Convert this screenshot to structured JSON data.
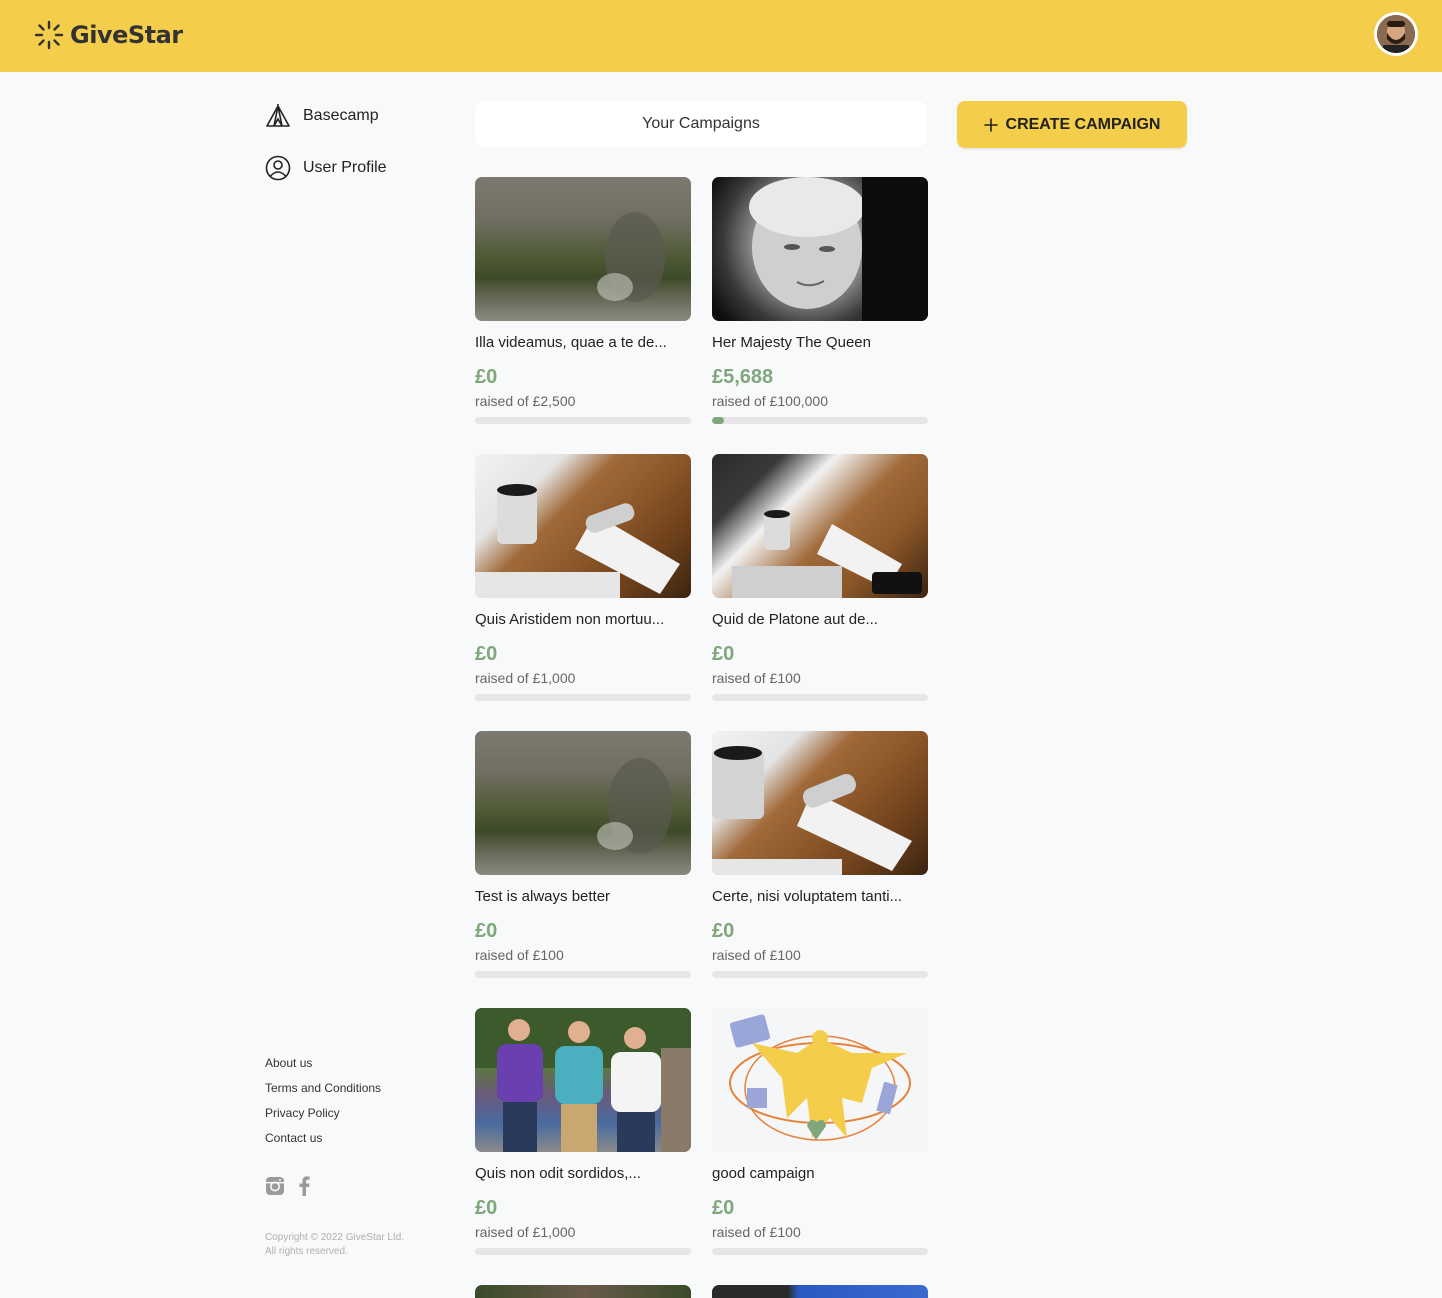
{
  "brand": {
    "name": "GiveStar",
    "color": "#f4ce4a"
  },
  "user": {
    "avatar_icon": "user-avatar"
  },
  "sidebar": {
    "items": [
      {
        "label": "Basecamp",
        "icon": "tent-icon"
      },
      {
        "label": "User Profile",
        "icon": "user-circle-icon"
      }
    ]
  },
  "main": {
    "tab_label": "Your Campaigns",
    "create_label": "CREATE CAMPAIGN"
  },
  "campaigns": [
    {
      "title": "Illa videamus, quae a te de...",
      "raised": "£0",
      "goal": "raised of £2,500",
      "progress": 0
    },
    {
      "title": "Her Majesty The Queen",
      "raised": "£5,688",
      "goal": "raised of £100,000",
      "progress": 0.057
    },
    {
      "title": "Quis Aristidem non mortuu...",
      "raised": "£0",
      "goal": "raised of £1,000",
      "progress": 0
    },
    {
      "title": "Quid de Platone aut de...",
      "raised": "£0",
      "goal": "raised of £100",
      "progress": 0
    },
    {
      "title": "Test is always better",
      "raised": "£0",
      "goal": "raised of £100",
      "progress": 0
    },
    {
      "title": "Certe, nisi voluptatem tanti...",
      "raised": "£0",
      "goal": "raised of £100",
      "progress": 0
    },
    {
      "title": "Quis non odit sordidos,...",
      "raised": "£0",
      "goal": "raised of £1,000",
      "progress": 0
    },
    {
      "title": "good campaign",
      "raised": "£0",
      "goal": "raised of £100",
      "progress": 0
    }
  ],
  "footer": {
    "links": [
      "About us",
      "Terms and Conditions",
      "Privacy Policy",
      "Contact us"
    ],
    "social": [
      "instagram-icon",
      "facebook-icon"
    ],
    "copyright": "Copyright © 2022 GiveStar Ltd. All rights reserved."
  }
}
